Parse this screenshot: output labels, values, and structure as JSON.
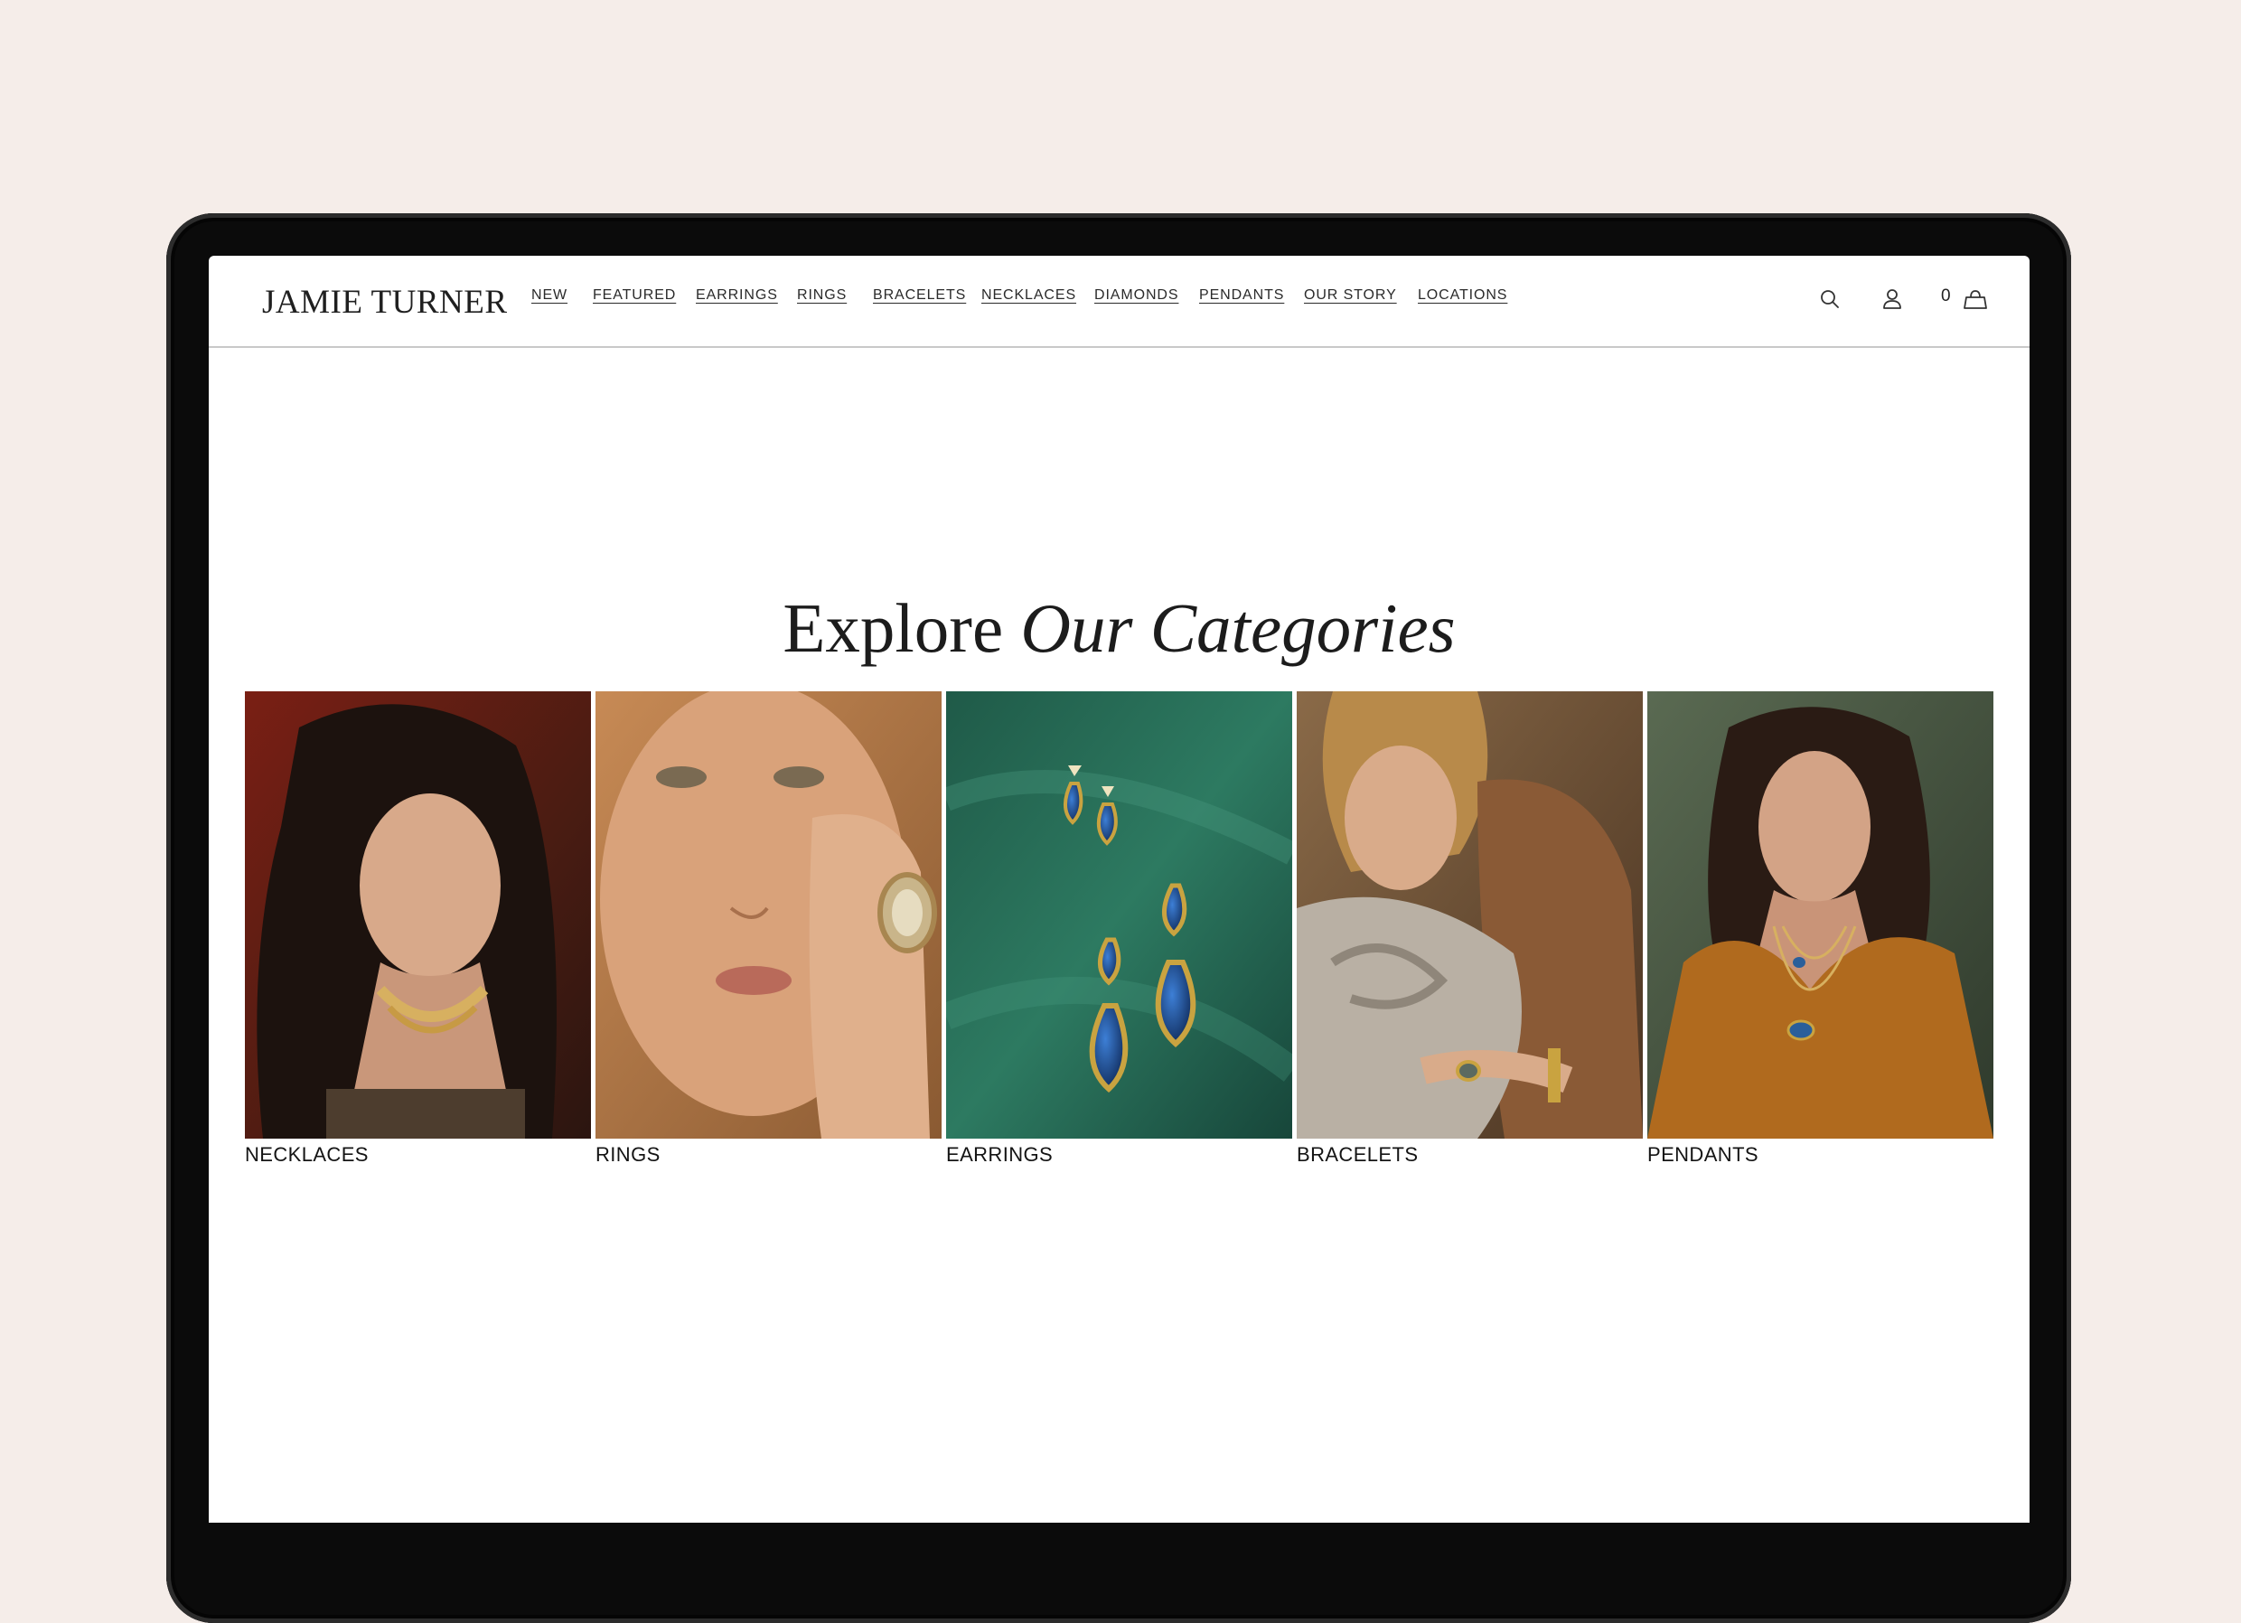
{
  "header": {
    "logo": "JAMIE TURNER",
    "nav": [
      "NEW",
      "FEATURED",
      "EARRINGS",
      "RINGS",
      "BRACELETS",
      "NECKLACES",
      "DIAMONDS",
      "PENDANTS",
      "OUR STORY",
      "LOCATIONS"
    ],
    "icons": [
      "search-icon",
      "account-icon",
      "cart-bag-icon"
    ],
    "cart_count": "0"
  },
  "section": {
    "title_regular": "Explore",
    "title_italic": "Our Categories"
  },
  "categories": [
    {
      "label": "NECKLACES"
    },
    {
      "label": "RINGS"
    },
    {
      "label": "EARRINGS"
    },
    {
      "label": "BRACELETS"
    },
    {
      "label": "PENDANTS"
    }
  ],
  "colors": {
    "backdrop": "#f5ede9",
    "laptop_bezel": "#0b0b0b",
    "text": "#1c1c1c"
  }
}
